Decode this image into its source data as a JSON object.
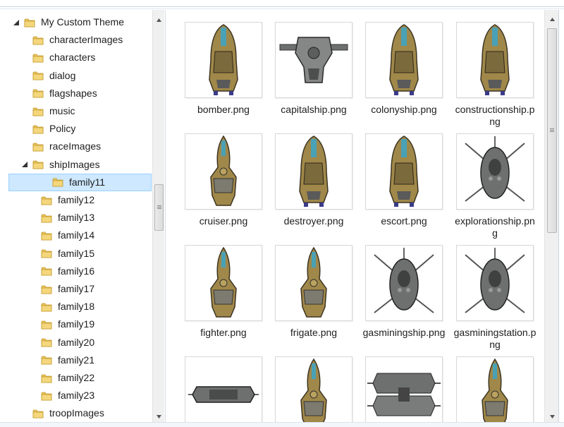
{
  "tree": {
    "items": [
      {
        "label": "My Custom Theme",
        "level": 0,
        "expanded": true
      },
      {
        "label": "characterImages",
        "level": 1
      },
      {
        "label": "characters",
        "level": 1
      },
      {
        "label": "dialog",
        "level": 1
      },
      {
        "label": "flagshapes",
        "level": 1
      },
      {
        "label": "music",
        "level": 1
      },
      {
        "label": "Policy",
        "level": 1
      },
      {
        "label": "raceImages",
        "level": 1
      },
      {
        "label": "shipImages",
        "level": 1,
        "expanded": true
      },
      {
        "label": "family11",
        "level": 2,
        "selected": true
      },
      {
        "label": "family12",
        "level": 2
      },
      {
        "label": "family13",
        "level": 2
      },
      {
        "label": "family14",
        "level": 2
      },
      {
        "label": "family15",
        "level": 2
      },
      {
        "label": "family16",
        "level": 2
      },
      {
        "label": "family17",
        "level": 2
      },
      {
        "label": "family18",
        "level": 2
      },
      {
        "label": "family19",
        "level": 2
      },
      {
        "label": "family20",
        "level": 2
      },
      {
        "label": "family21",
        "level": 2
      },
      {
        "label": "family22",
        "level": 2
      },
      {
        "label": "family23",
        "level": 2
      },
      {
        "label": "troopImages",
        "level": 1
      }
    ]
  },
  "files": [
    {
      "name": "bomber.png",
      "ship": "tall-gold"
    },
    {
      "name": "capitalship.png",
      "ship": "wide-grey"
    },
    {
      "name": "colonyship.png",
      "ship": "tall-gold"
    },
    {
      "name": "constructionship.png",
      "ship": "tall-gold"
    },
    {
      "name": "cruiser.png",
      "ship": "slim-gold"
    },
    {
      "name": "destroyer.png",
      "ship": "tall-gold"
    },
    {
      "name": "escort.png",
      "ship": "tall-gold"
    },
    {
      "name": "explorationship.png",
      "ship": "spiky-grey"
    },
    {
      "name": "fighter.png",
      "ship": "slim-gold"
    },
    {
      "name": "frigate.png",
      "ship": "slim-gold"
    },
    {
      "name": "gasminingship.png",
      "ship": "spiky-grey"
    },
    {
      "name": "gasminingstation.png",
      "ship": "spiky-grey"
    },
    {
      "name": "",
      "ship": "flat-grey"
    },
    {
      "name": "",
      "ship": "slim-gold"
    },
    {
      "name": "",
      "ship": "double-grey"
    },
    {
      "name": "",
      "ship": "slim-gold"
    }
  ],
  "icons": {
    "folder": "folder-icon",
    "expander": "expander-open-icon",
    "scroll_up": "scroll-up-arrow-icon",
    "scroll_down": "scroll-down-arrow-icon"
  },
  "colors": {
    "selection_bg": "#cde8ff",
    "selection_border": "#99d1ff",
    "folder": "#e8c25a",
    "ship_gold": "#a0884a",
    "ship_grey": "#6e7070",
    "ship_accent": "#3aa6c8"
  }
}
